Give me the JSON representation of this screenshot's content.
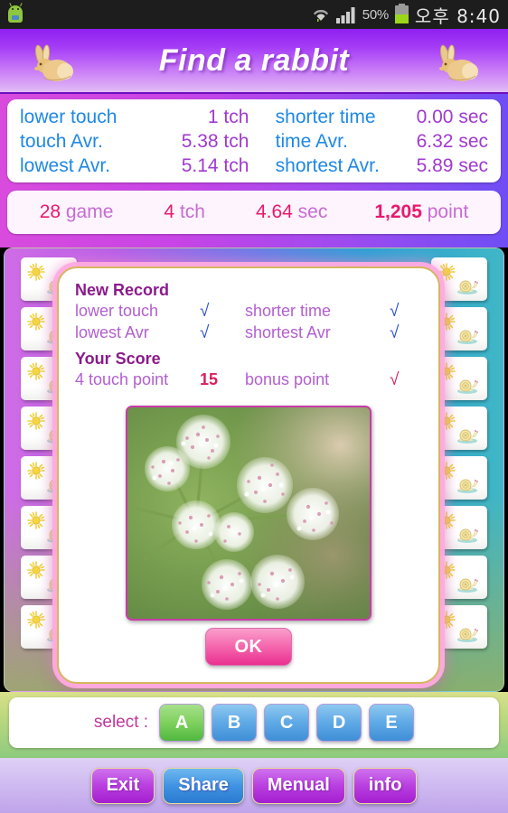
{
  "statusbar": {
    "battery_percent": "50%",
    "clock": "오후 8:40",
    "icons": [
      "android-robot-icon",
      "wifi-icon",
      "signal-icon",
      "battery-icon"
    ]
  },
  "titlebar": {
    "title": "Find a rabbit",
    "left_icon": "rabbit-icon",
    "right_icon": "rabbit-icon"
  },
  "stats": {
    "rows": [
      {
        "label_left": "lower touch",
        "value_left": "1 tch",
        "label_right": "shorter time",
        "value_right": "0.00 sec"
      },
      {
        "label_left": "touch Avr.",
        "value_left": "5.38 tch",
        "label_right": "time Avr.",
        "value_right": "6.32 sec"
      },
      {
        "label_left": "lowest Avr.",
        "value_left": "5.14 tch",
        "label_right": "shortest Avr.",
        "value_right": "5.89 sec"
      }
    ],
    "summary": {
      "games_num": "28",
      "games_unit": " game",
      "touch_num": "4",
      "touch_unit": " tch",
      "time_num": "4.64",
      "time_unit": " sec",
      "point_num": "1,205",
      "point_unit": " point"
    },
    "label_color": "#1e88e5",
    "value_color": "#a03ad0",
    "number_color": "#e8196e"
  },
  "board": {
    "card_icons": [
      "sun-icon",
      "snail-icon"
    ],
    "left_card_count": 8,
    "right_card_count": 8
  },
  "dialog": {
    "new_record_header": "New Record",
    "record_rows": [
      {
        "label": "lower touch",
        "check": "√",
        "label2": "shorter time",
        "check2": "√"
      },
      {
        "label": "lowest Avr",
        "check": "√",
        "label2": "shortest Avr",
        "check2": "√"
      }
    ],
    "your_score_header": "Your Score",
    "score_row": {
      "touch_num": "4",
      "touch_label": " touch point",
      "bonus_num": "15",
      "bonus_label": "bonus point",
      "bonus_check": "√"
    },
    "photo_alt": "white-pink-umbel-flowers-photo",
    "ok_label": "OK"
  },
  "select": {
    "label": "select :",
    "options": [
      "A",
      "B",
      "C",
      "D",
      "E"
    ],
    "selected": "A",
    "selected_color": "#4fb83f",
    "unselected_color": "#3f8fd6"
  },
  "bottom": {
    "buttons": [
      {
        "label": "Exit",
        "style": "purple"
      },
      {
        "label": "Share",
        "style": "blue"
      },
      {
        "label": "Menual",
        "style": "purple"
      },
      {
        "label": "info",
        "style": "purple"
      }
    ]
  }
}
